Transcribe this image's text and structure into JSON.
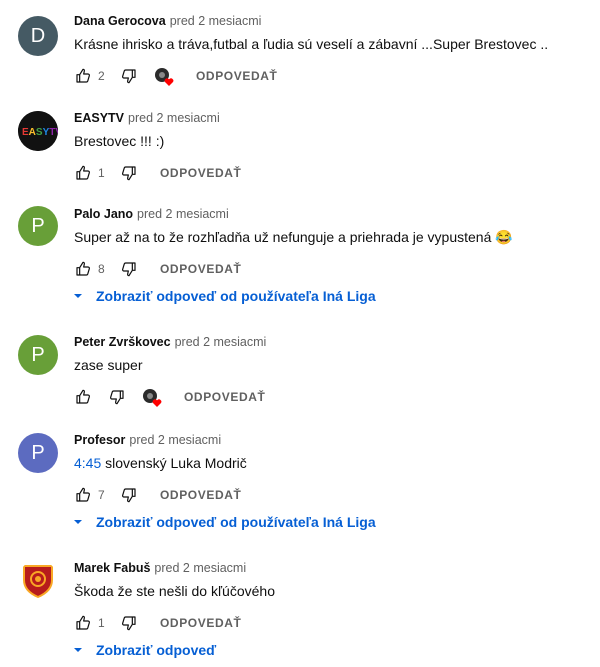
{
  "comments": [
    {
      "author": "Dana Gerocova",
      "time": "pred 2 mesiacmi",
      "text": "Krásne ihrisko a tráva,futbal a ľudia sú veselí a zábavní  ...Super Brestovec ..",
      "likes": "2",
      "reply": "ODPOVEDAŤ",
      "avatar_letter": "D",
      "avatar_color": "#455a64"
    },
    {
      "author": "EASYTV",
      "time": "pred 2 mesiacmi",
      "text": "Brestovec !!! :)",
      "likes": "1",
      "reply": "ODPOVEDAŤ",
      "avatar_logo": "EASYTV"
    },
    {
      "author": "Palo Jano",
      "time": "pred 2 mesiacmi",
      "text": "Super až na to že rozhľadňa už nefunguje a priehrada je vypustená 😂",
      "likes": "8",
      "reply": "ODPOVEDAŤ",
      "avatar_letter": "P",
      "avatar_color": "#689f38",
      "view_replies": "Zobraziť odpoveď od používateľa Iná Liga"
    },
    {
      "author": "Peter Zvrškovec",
      "time": "pred 2 mesiacmi",
      "text": "zase super",
      "likes": "",
      "reply": "ODPOVEDAŤ",
      "avatar_letter": "P",
      "avatar_color": "#689f38"
    },
    {
      "author": "Profesor",
      "time": "pred 2 mesiacmi",
      "text_ts": "4:45",
      "text": " slovenský Luka Modrič",
      "likes": "7",
      "reply": "ODPOVEDAŤ",
      "avatar_letter": "P",
      "avatar_color": "#5c6bc0",
      "view_replies": "Zobraziť odpoveď od používateľa Iná Liga"
    },
    {
      "author": "Marek Fabuš",
      "time": "pred 2 mesiacmi",
      "text": "Škoda že ste nešli do kľúčového",
      "likes": "1",
      "reply": "ODPOVEDAŤ",
      "view_replies": "Zobraziť odpoveď"
    }
  ],
  "colors": {
    "link": "#065fd4",
    "secondary": "#606060",
    "heart": "#ff0000"
  },
  "icons": {
    "like": "thumb-up-icon",
    "dislike": "thumb-down-icon",
    "heart": "creator-heart-icon",
    "expand": "chevron-down-icon"
  }
}
